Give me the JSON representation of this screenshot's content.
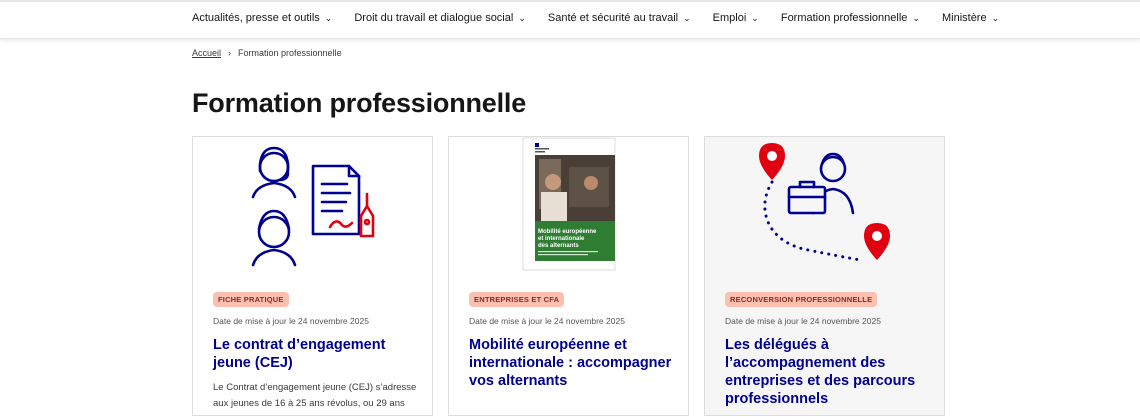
{
  "nav": {
    "items": [
      {
        "label": "Actualités, presse et outils"
      },
      {
        "label": "Droit du travail et dialogue social"
      },
      {
        "label": "Santé et sécurité au travail"
      },
      {
        "label": "Emploi"
      },
      {
        "label": "Formation professionnelle"
      },
      {
        "label": "Ministère"
      }
    ]
  },
  "breadcrumb": {
    "home": "Accueil",
    "current": "Formation professionnelle"
  },
  "page": {
    "title": "Formation professionnelle"
  },
  "cards": [
    {
      "badge": "FICHE PRATIQUE",
      "date": "Date de mise à jour le 24 novembre 2025",
      "title": "Le contrat d’engagement jeune (CEJ)",
      "description": "Le Contrat d’engagement jeune (CEJ) s’adresse aux jeunes de 16 à 25 ans révolus, ou 29 ans",
      "illustration": "people-contract-illustration"
    },
    {
      "badge": "ENTREPRISES ET CFA",
      "date": "Date de mise à jour le 24 novembre 2025",
      "title": "Mobilité européenne et internationale : accompagner vos alternants",
      "description": "",
      "cover_title": "Mobilité européenne et internationale des alternants",
      "illustration": "brochure-cover"
    },
    {
      "badge": "RECONVERSION PROFESSIONNELLE",
      "date": "Date de mise à jour le 24 novembre 2025",
      "title": "Les délégués à l’accompagnement des entreprises et des parcours professionnels",
      "description": "",
      "illustration": "route-map-illustration"
    }
  ],
  "colors": {
    "primary_blue": "#000091",
    "marker_red": "#e1000f",
    "badge_bg": "#fcc0b0",
    "badge_text": "#8b2b1c"
  }
}
